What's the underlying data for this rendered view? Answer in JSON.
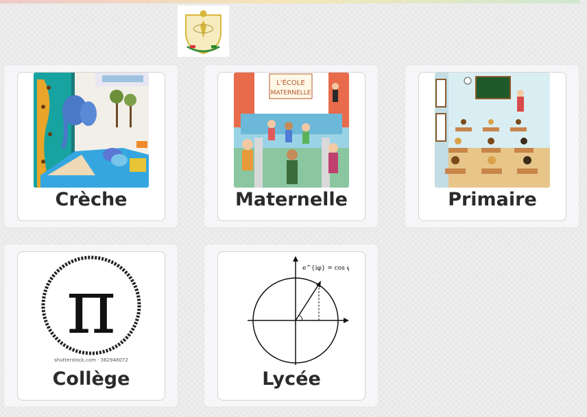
{
  "header": {
    "logo_alt_text": "Armoiries de la République de Guinée"
  },
  "cards": [
    {
      "label": "Crèche",
      "image": "nursery-room-photo"
    },
    {
      "label": "Maternelle",
      "image": "kindergarten-illustration",
      "image_text": "L'ÉCOLE MATERNELLE"
    },
    {
      "label": "Primaire",
      "image": "classroom-illustration"
    },
    {
      "label": "Collège",
      "image": "pi-symbol",
      "image_text": "shutterstock.com · 362948072"
    },
    {
      "label": "Lycée",
      "image": "unit-circle-diagram",
      "image_text": "e^{iφ} = cos φ + i sin φ"
    }
  ],
  "colors": {
    "page_bg": "#eeeeee",
    "panel_bg": "#f6f6f8",
    "card_border": "#d3d3d3",
    "label_color": "#2b2b2b"
  }
}
